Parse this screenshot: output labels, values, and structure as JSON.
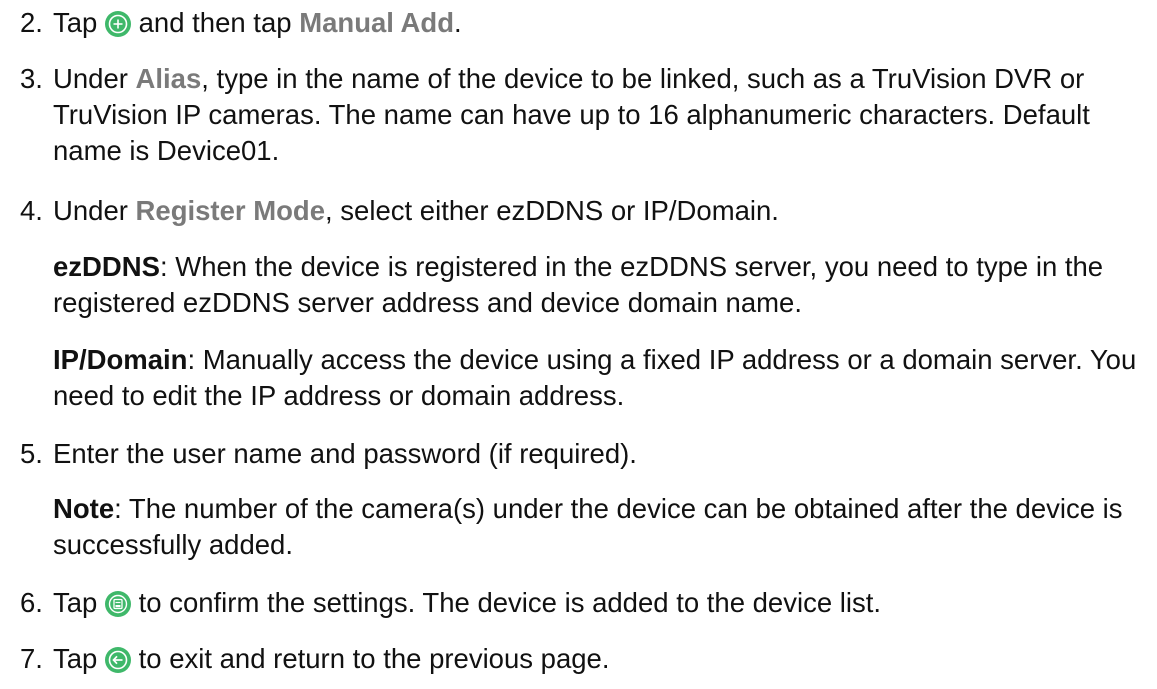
{
  "colors": {
    "icon_green": "#3fb86a",
    "label_gray": "#7a7a7a"
  },
  "icons": {
    "add": "plus-circle-icon",
    "save": "save-icon",
    "back": "back-arrow-icon"
  },
  "steps": [
    {
      "num": "2.",
      "a": "Tap",
      "b": "and then tap",
      "label": "Manual Add",
      "c": "."
    },
    {
      "num": "3.",
      "a": "Under",
      "label": "Alias",
      "b": ", type in the name of the device to be linked, such as a TruVision DVR or TruVision IP cameras. The name can have up to 16 alphanumeric characters. Default name is Device01."
    },
    {
      "num": "4.",
      "a": "Under",
      "label": "Register Mode",
      "b": ", select either ezDDNS or IP/Domain."
    },
    {
      "num": "5.",
      "text": "Enter the user name and password (if required)."
    },
    {
      "num": "6.",
      "a": "Tap",
      "b": "to confirm the settings. The device is added to the device list."
    },
    {
      "num": "7.",
      "a": "Tap",
      "b": "to exit and return to the previous page."
    }
  ],
  "ezddns": {
    "term": "ezDDNS",
    "text": ": When the device is registered in the ezDDNS server, you need to type in the registered ezDDNS server address and device domain name."
  },
  "ipdomain": {
    "term": "IP/Domain",
    "text": ": Manually access the device using a fixed IP address or a domain server. You need to edit the IP address or domain address."
  },
  "note": {
    "term": "Note",
    "text": ": The number of the camera(s) under the device can be obtained after the device is successfully added."
  }
}
